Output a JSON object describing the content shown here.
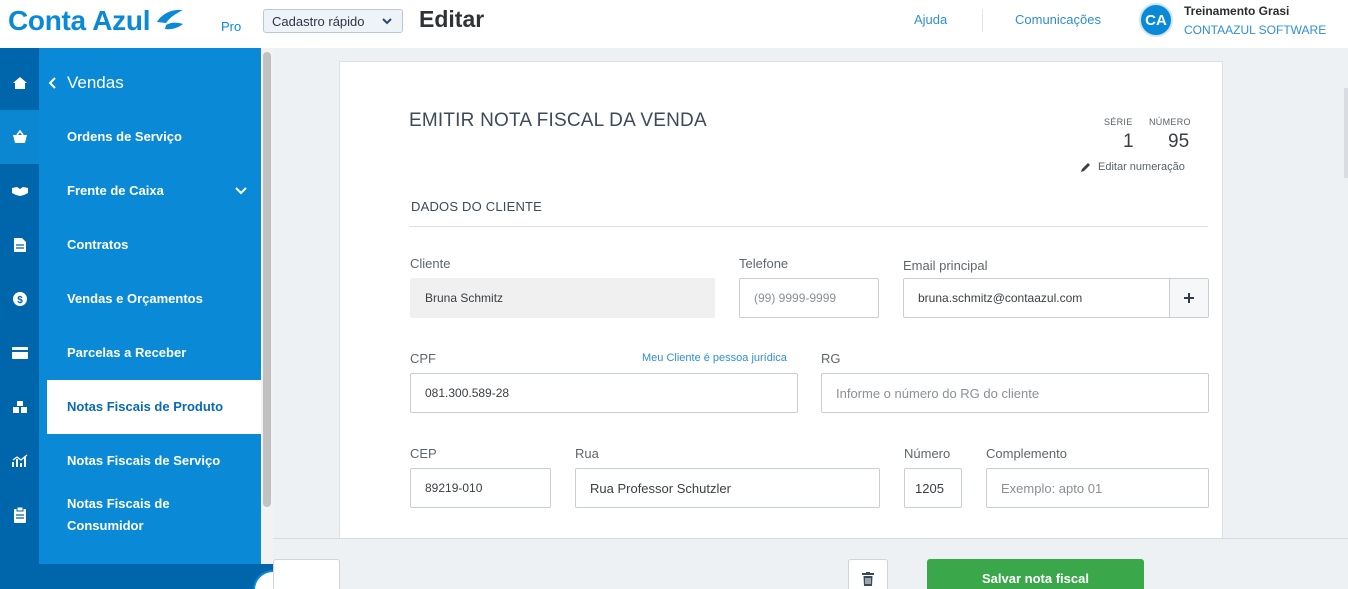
{
  "header": {
    "logo": "Conta Azul",
    "plan": "Pro",
    "quick_add": "Cadastro rápido",
    "page_title": "Editar",
    "help_link": "Ajuda",
    "news_link": "Comunicações",
    "avatar_initials": "CA",
    "user_name": "Treinamento Grasi",
    "user_company": "CONTAAZUL SOFTWARE"
  },
  "sidebar": {
    "section": "Vendas",
    "items": [
      {
        "label": "Ordens de Serviço"
      },
      {
        "label": "Frente de Caixa"
      },
      {
        "label": "Contratos"
      },
      {
        "label": "Vendas e Orçamentos"
      },
      {
        "label": "Parcelas a Receber"
      },
      {
        "label": "Notas Fiscais de Produto"
      },
      {
        "label": "Notas Fiscais de Serviço"
      },
      {
        "label": "Notas Fiscais de Consumidor"
      }
    ],
    "rail_icons": [
      "home-icon",
      "basket-icon",
      "handshake-icon",
      "document-icon",
      "dollar-icon",
      "card-icon",
      "boxes-icon",
      "chart-icon",
      "clipboard-icon"
    ]
  },
  "form": {
    "title": "EMITIR NOTA FISCAL DA VENDA",
    "serie_label": "SÉRIE",
    "serie_value": "1",
    "numero_label": "NÚMERO",
    "numero_value": "95",
    "edit_numbering": "Editar numeração",
    "section_title": "DADOS DO CLIENTE",
    "cliente_label": "Cliente",
    "cliente_value": "Bruna Schmitz",
    "telefone_label": "Telefone",
    "telefone_placeholder": "(99) 9999-9999",
    "email_label": "Email principal",
    "email_value": "bruna.schmitz@contaazul.com",
    "cpf_label": "CPF",
    "cpf_value": "081.300.589-28",
    "pj_link": "Meu Cliente é pessoa jurídica",
    "rg_label": "RG",
    "rg_placeholder": "Informe o número do RG do cliente",
    "cep_label": "CEP",
    "cep_value": "89219-010",
    "rua_label": "Rua",
    "rua_value": "Rua Professor Schutzler",
    "numero_end_label": "Número",
    "numero_end_value": "1205",
    "complemento_label": "Complemento",
    "complemento_placeholder": "Exemplo: apto 01"
  },
  "footer": {
    "save_label": "Salvar nota fiscal"
  },
  "colors": {
    "brand": "#0a8ad6",
    "rail": "#0066ac",
    "save": "#3aa84a",
    "link": "#2f8fd3"
  }
}
